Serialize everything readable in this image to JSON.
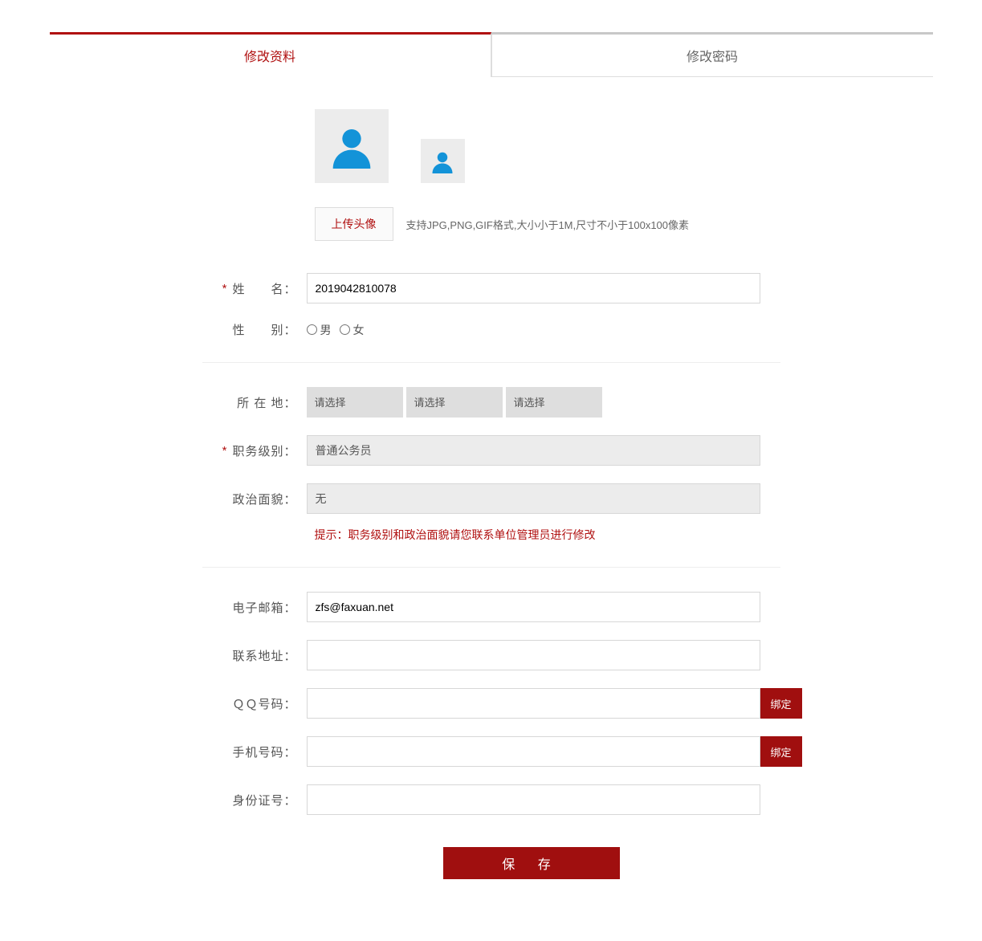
{
  "tabs": {
    "edit_profile": "修改资料",
    "edit_password": "修改密码"
  },
  "avatar": {
    "upload_btn": "上传头像",
    "upload_hint": "支持JPG,PNG,GIF格式,大小小于1M,尺寸不小于100x100像素"
  },
  "labels": {
    "name": "姓　　名：",
    "gender": "性　　别：",
    "location": "所 在 地：",
    "job_level": "职务级别：",
    "political": "政治面貌：",
    "email": "电子邮箱：",
    "address": "联系地址：",
    "qq": "ＱＱ号码：",
    "phone": "手机号码：",
    "idcard": "身份证号："
  },
  "values": {
    "name": "2019042810078",
    "gender_male": "男",
    "gender_female": "女",
    "location_sel": "请选择",
    "job_level": "普通公务员",
    "political": "无",
    "email": "zfs@faxuan.net",
    "address": "",
    "qq": "",
    "phone": "",
    "idcard": ""
  },
  "tip": "提示：职务级别和政治面貌请您联系单位管理员进行修改",
  "buttons": {
    "bind": "绑定",
    "save": "保  存"
  }
}
